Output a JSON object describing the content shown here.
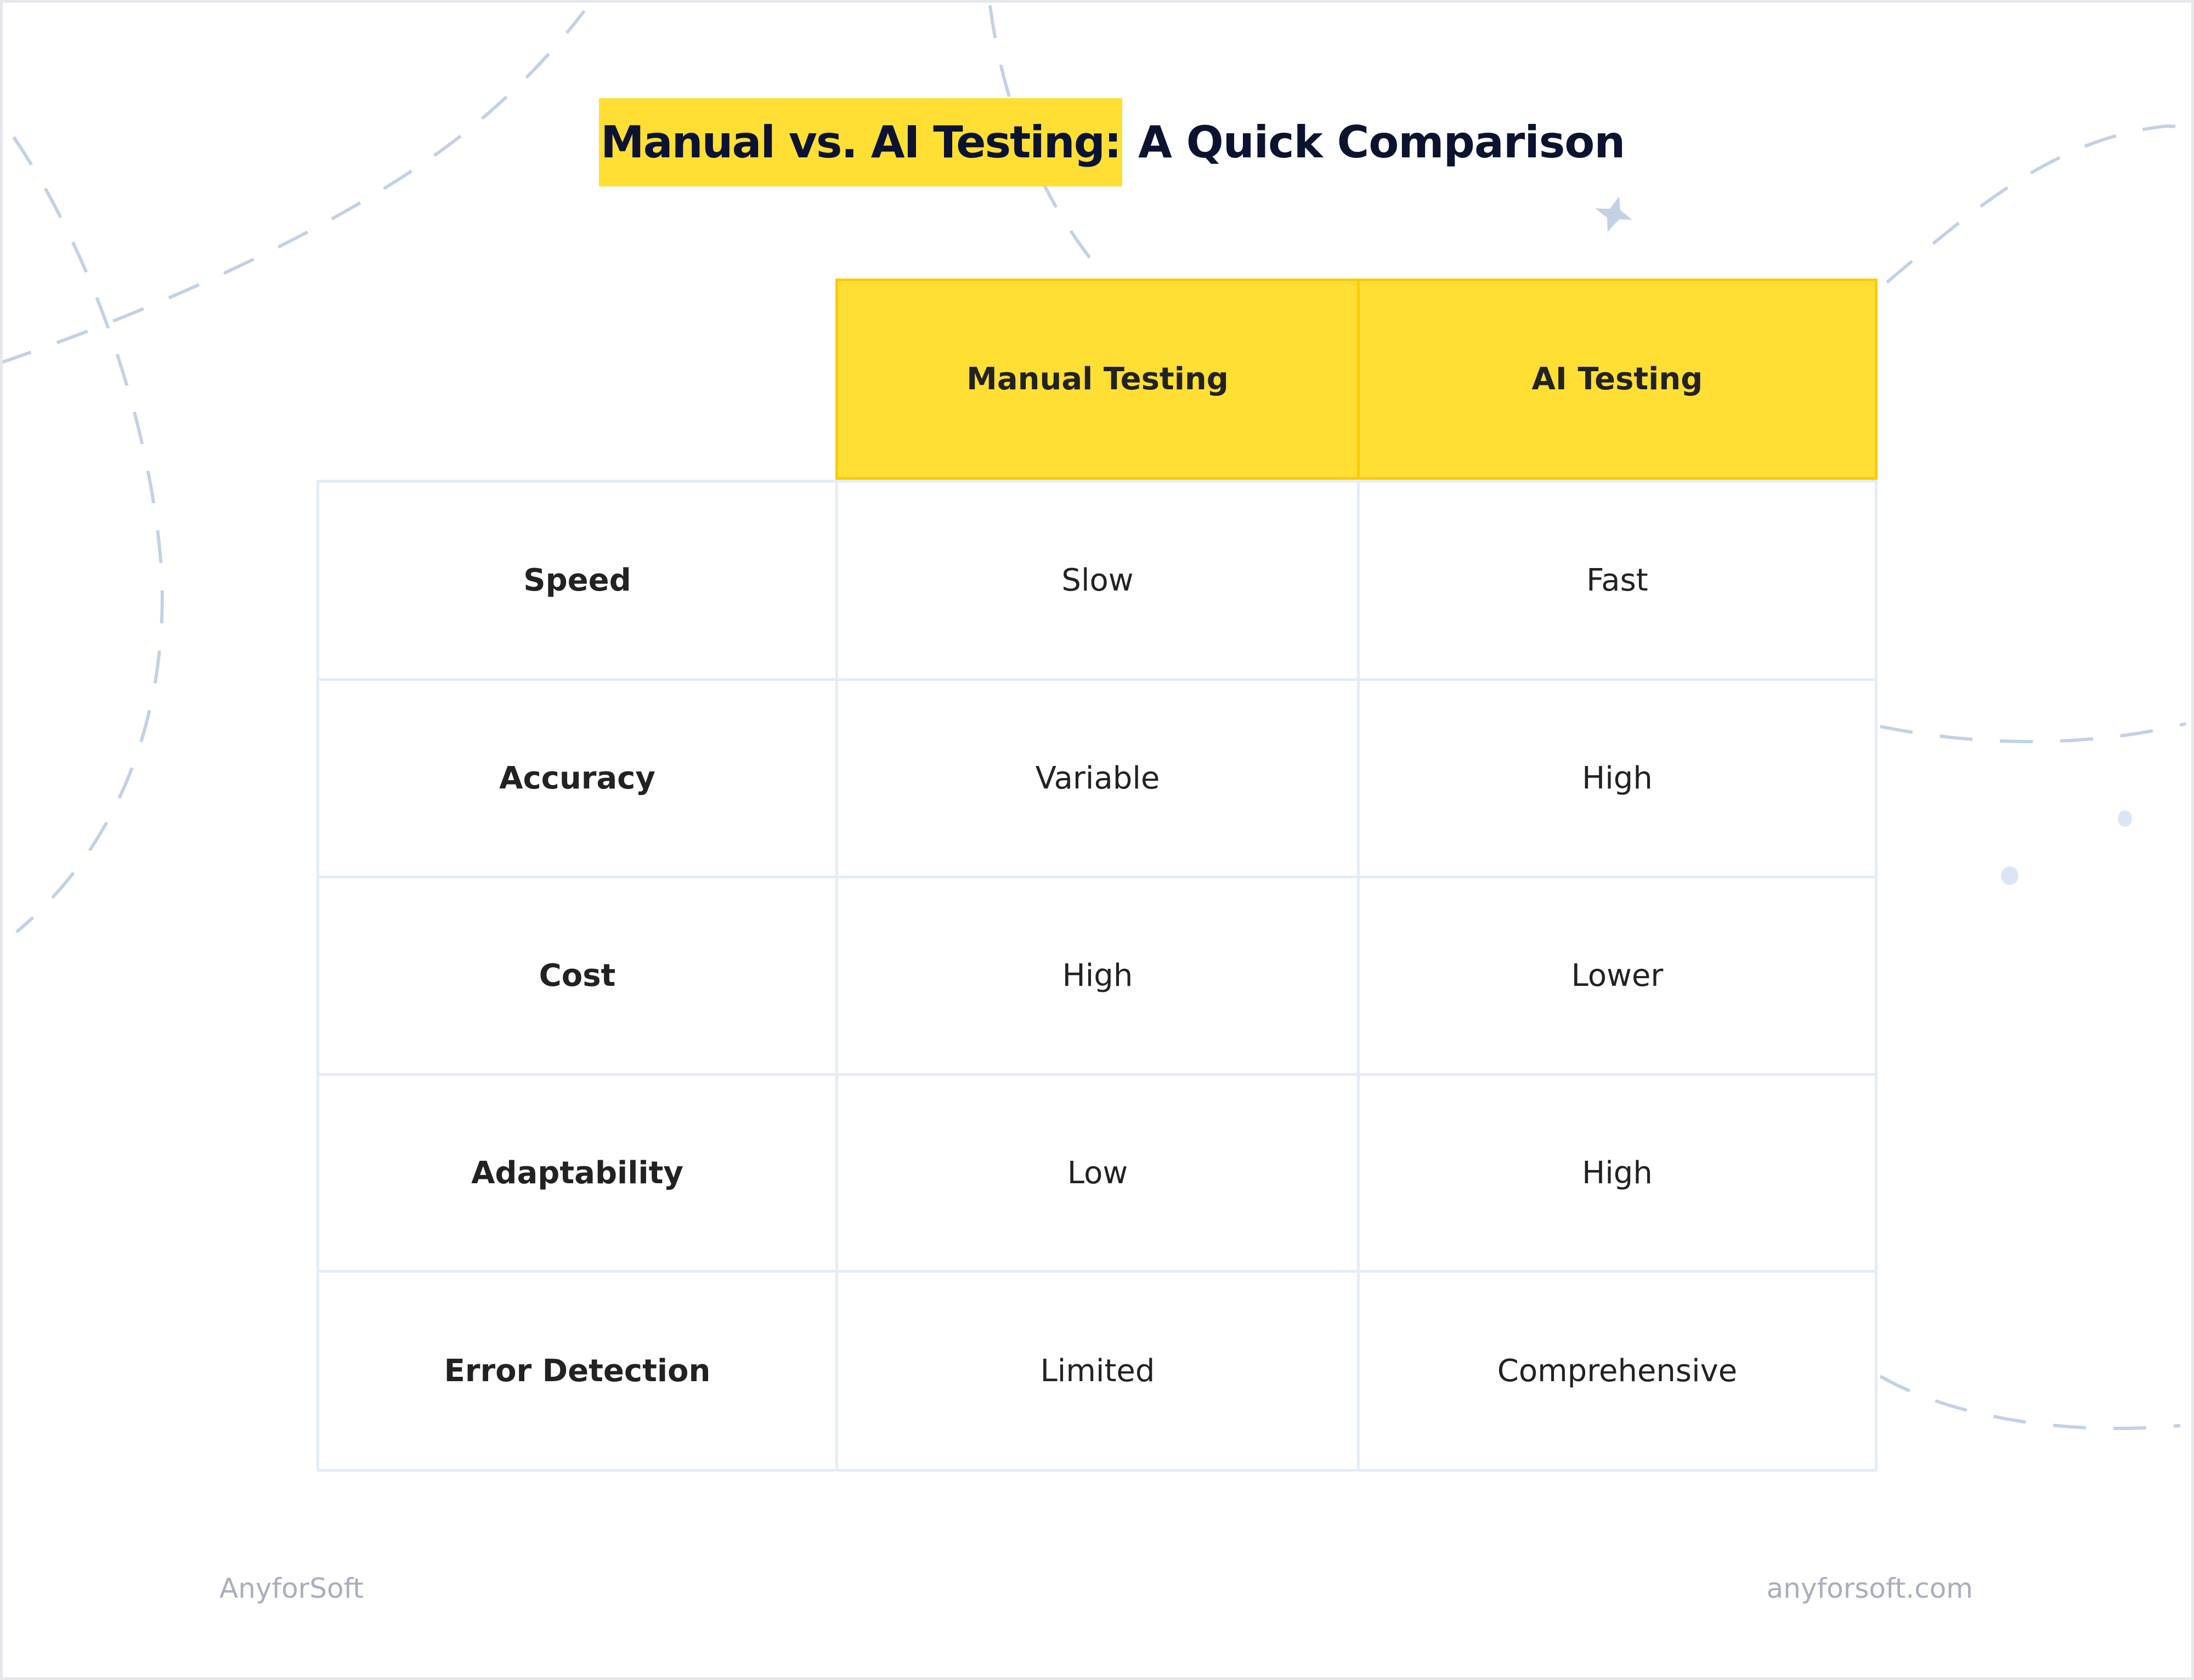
{
  "title": {
    "highlight": "Manual vs. AI Testing:",
    "rest": "A Quick Comparison"
  },
  "colors": {
    "accent_yellow": "#ffdf33",
    "accent_yellow_border": "#fccb05",
    "title_text": "#0b1330",
    "cell_text": "#222222",
    "grid_line": "#e4ecf6",
    "decoration": "#c3d1e6",
    "footer_text": "#a9aebf"
  },
  "table": {
    "headers": [
      "Manual Testing",
      "AI Testing"
    ],
    "rows": [
      {
        "label": "Speed",
        "manual": "Slow",
        "ai": "Fast"
      },
      {
        "label": "Accuracy",
        "manual": "Variable",
        "ai": "High"
      },
      {
        "label": "Cost",
        "manual": "High",
        "ai": "Lower"
      },
      {
        "label": "Adaptability",
        "manual": "Low",
        "ai": "High"
      },
      {
        "label": "Error Detection",
        "manual": "Limited",
        "ai": "Comprehensive"
      }
    ]
  },
  "footer": {
    "brand": "AnyforSoft",
    "website": "anyforsoft.com"
  },
  "decorations": {
    "icons": [
      "sparkle-star-icon",
      "dot-icon",
      "dot-icon"
    ]
  }
}
